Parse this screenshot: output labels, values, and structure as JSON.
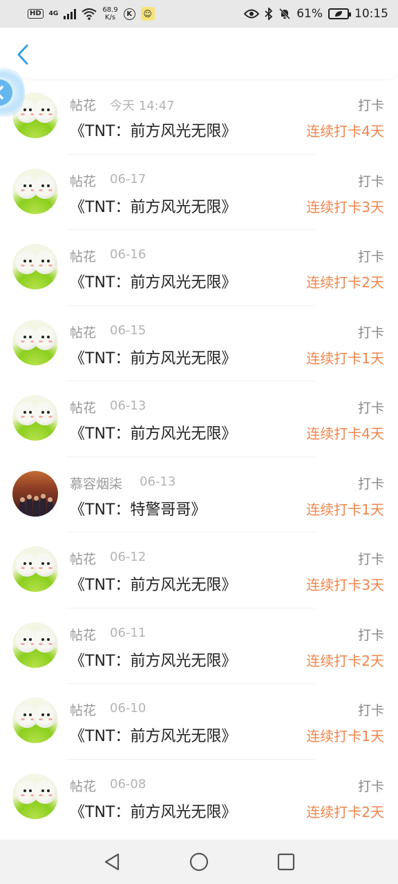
{
  "status_bar": {
    "hd": "HD",
    "signal_type": "4G",
    "speed_value": "68.9",
    "speed_unit": "K/s",
    "k_badge": "K",
    "battery_percent": "61%",
    "time": "10:15"
  },
  "list": {
    "items": [
      {
        "author": "帖花",
        "time": "今天 14:47",
        "title": "《TNT：前方风光无限》",
        "tag": "打卡",
        "streak": "连续打卡4天",
        "avatar": "bun"
      },
      {
        "author": "帖花",
        "time": "06-17",
        "title": "《TNT：前方风光无限》",
        "tag": "打卡",
        "streak": "连续打卡3天",
        "avatar": "bun"
      },
      {
        "author": "帖花",
        "time": "06-16",
        "title": "《TNT：前方风光无限》",
        "tag": "打卡",
        "streak": "连续打卡2天",
        "avatar": "bun"
      },
      {
        "author": "帖花",
        "time": "06-15",
        "title": "《TNT：前方风光无限》",
        "tag": "打卡",
        "streak": "连续打卡1天",
        "avatar": "bun"
      },
      {
        "author": "帖花",
        "time": "06-13",
        "title": "《TNT：前方风光无限》",
        "tag": "打卡",
        "streak": "连续打卡4天",
        "avatar": "bun"
      },
      {
        "author": "慕容烟柒",
        "time": "06-13",
        "title": "《TNT：特警哥哥》",
        "tag": "打卡",
        "streak": "连续打卡1天",
        "avatar": "photo"
      },
      {
        "author": "帖花",
        "time": "06-12",
        "title": "《TNT：前方风光无限》",
        "tag": "打卡",
        "streak": "连续打卡3天",
        "avatar": "bun"
      },
      {
        "author": "帖花",
        "time": "06-11",
        "title": "《TNT：前方风光无限》",
        "tag": "打卡",
        "streak": "连续打卡2天",
        "avatar": "bun"
      },
      {
        "author": "帖花",
        "time": "06-10",
        "title": "《TNT：前方风光无限》",
        "tag": "打卡",
        "streak": "连续打卡1天",
        "avatar": "bun"
      },
      {
        "author": "帖花",
        "time": "06-08",
        "title": "《TNT：前方风光无限》",
        "tag": "打卡",
        "streak": "连续打卡2天",
        "avatar": "bun"
      }
    ]
  },
  "colors": {
    "accent": "#f0854b",
    "back_icon": "#3aa0e6",
    "status_bar_bg": "#e8e8e8"
  },
  "icons": {
    "back": "chevron-left-icon",
    "nav_back": "triangle-back-icon",
    "nav_home": "circle-home-icon",
    "nav_recent": "square-recent-icon"
  }
}
